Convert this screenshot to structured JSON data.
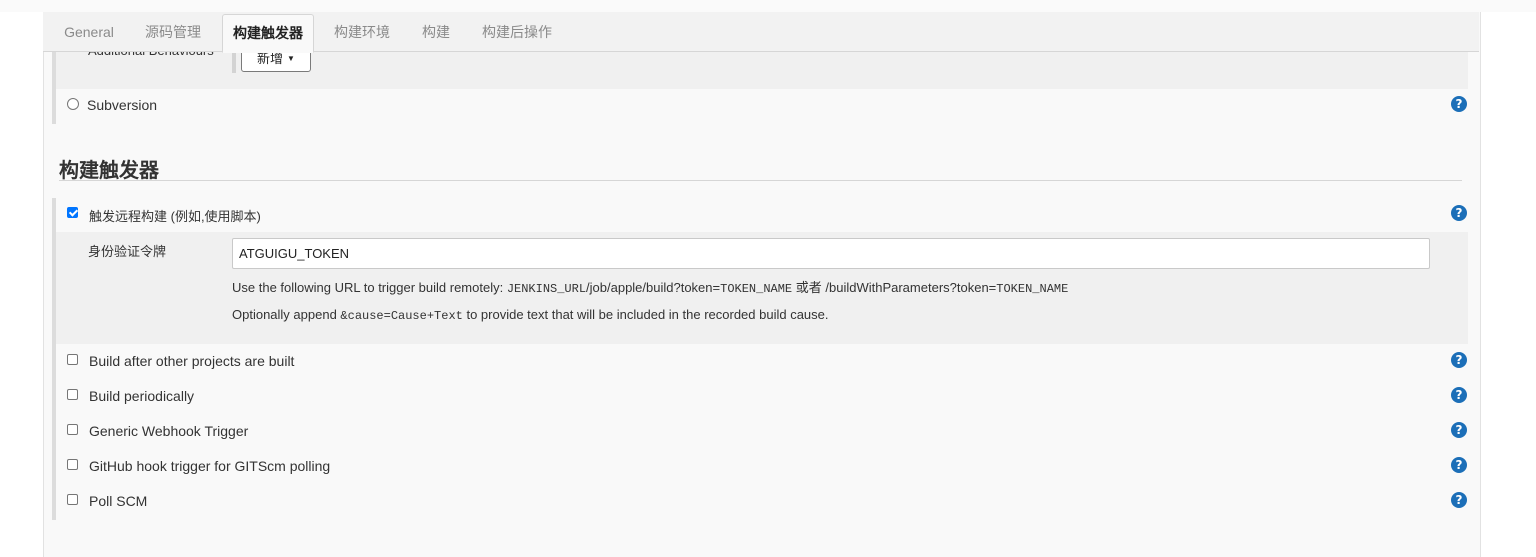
{
  "tabs": [
    {
      "label": "General"
    },
    {
      "label": "源码管理"
    },
    {
      "label": "构建触发器"
    },
    {
      "label": "构建环境"
    },
    {
      "label": "构建"
    },
    {
      "label": "构建后操作"
    }
  ],
  "scm": {
    "additional_behaviours_label": "Additional Behaviours",
    "add_button_label": "新增",
    "subversion_label": "Subversion"
  },
  "help_glyph": "?",
  "triggers_section": {
    "title": "构建触发器",
    "remote_trigger": {
      "label": "触发远程构建 (例如,使用脚本)",
      "checked": true,
      "token_label": "身份验证令牌",
      "token_value": "ATGUIGU_TOKEN",
      "desc1_prefix": "Use the following URL to trigger build remotely: ",
      "desc1_code1": "JENKINS_URL",
      "desc1_mid": "/job/apple/build?token=",
      "desc1_code2": "TOKEN_NAME",
      "desc1_or": " 或者 ",
      "desc1_path2": "/buildWithParameters?token=",
      "desc1_code3": "TOKEN_NAME",
      "desc2_prefix": "Optionally append ",
      "desc2_code": "&cause=Cause+Text",
      "desc2_suffix": " to provide text that will be included in the recorded build cause."
    },
    "options": [
      {
        "label": "Build after other projects are built",
        "checked": false
      },
      {
        "label": "Build periodically",
        "checked": false
      },
      {
        "label": "Generic Webhook Trigger",
        "checked": false
      },
      {
        "label": "GitHub hook trigger for GITScm polling",
        "checked": false
      },
      {
        "label": "Poll SCM",
        "checked": false
      }
    ]
  },
  "colors": {
    "help_icon": "#1c6fb8",
    "checkbox_checked": "#0075ff"
  }
}
